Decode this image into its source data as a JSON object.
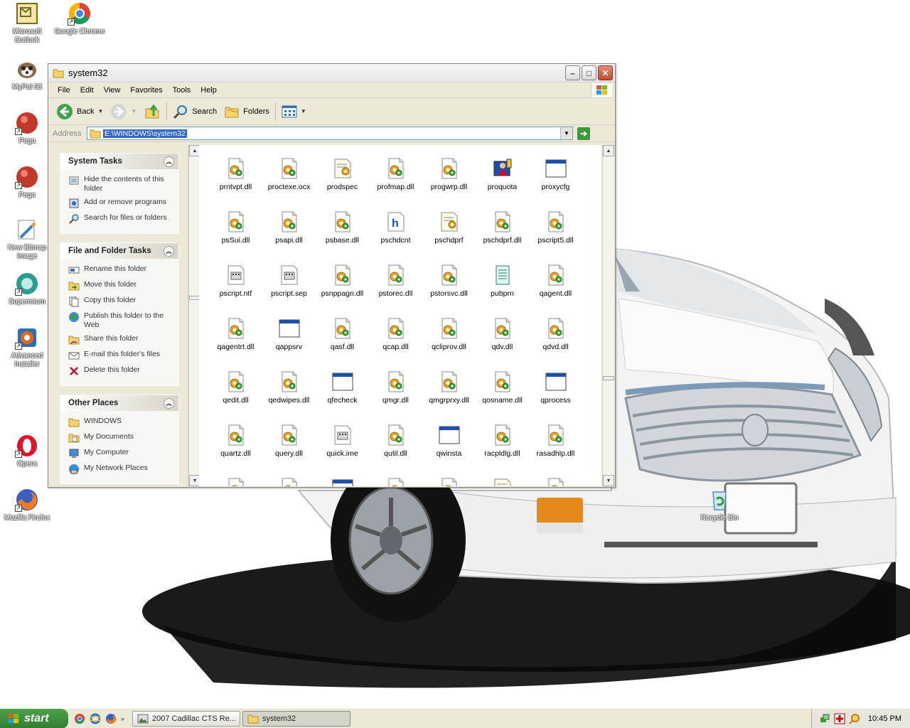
{
  "desktop": {
    "icons": [
      {
        "label": "Microsoft Outlook",
        "icon": "outlook-icon"
      },
      {
        "label": "Google Chrome",
        "icon": "chrome-icon"
      },
      {
        "label": "MyPal 68",
        "icon": "mypal-icon"
      },
      {
        "label": "Pego",
        "icon": "pego-icon"
      },
      {
        "label": "Pego",
        "icon": "pego-icon"
      },
      {
        "label": "New Bitmap Image",
        "icon": "bitmap-icon"
      },
      {
        "label": "Supermium",
        "icon": "supermium-icon"
      },
      {
        "label": "Advanced Installer",
        "icon": "installer-icon"
      },
      {
        "label": "Opera",
        "icon": "opera-icon"
      },
      {
        "label": "Mozilla Firefox",
        "icon": "firefox-icon"
      },
      {
        "label": "Recycle Bin",
        "icon": "recycle-bin-icon"
      }
    ]
  },
  "window": {
    "title": "system32",
    "menu": [
      "File",
      "Edit",
      "View",
      "Favorites",
      "Tools",
      "Help"
    ],
    "toolbar": {
      "back": "Back",
      "search": "Search",
      "folders": "Folders"
    },
    "address": {
      "label": "Address",
      "value": "E:\\WINDOWS\\system32"
    },
    "panels": [
      {
        "title": "System Tasks",
        "tasks": [
          {
            "label": "Hide the contents of this folder",
            "icon": "hide-icon"
          },
          {
            "label": "Add or remove programs",
            "icon": "add-remove-icon"
          },
          {
            "label": "Search for files or folders",
            "icon": "search-icon"
          }
        ]
      },
      {
        "title": "File and Folder Tasks",
        "tasks": [
          {
            "label": "Rename this folder",
            "icon": "rename-icon"
          },
          {
            "label": "Move this folder",
            "icon": "move-icon"
          },
          {
            "label": "Copy this folder",
            "icon": "copy-icon"
          },
          {
            "label": "Publish this folder to the Web",
            "icon": "publish-icon"
          },
          {
            "label": "Share this folder",
            "icon": "share-icon"
          },
          {
            "label": "E-mail this folder's files",
            "icon": "email-icon"
          },
          {
            "label": "Delete this folder",
            "icon": "delete-icon"
          }
        ]
      },
      {
        "title": "Other Places",
        "tasks": [
          {
            "label": "WINDOWS",
            "icon": "folder-icon"
          },
          {
            "label": "My Documents",
            "icon": "documents-icon"
          },
          {
            "label": "My Computer",
            "icon": "computer-icon"
          },
          {
            "label": "My Network Places",
            "icon": "network-icon"
          }
        ]
      }
    ],
    "files": [
      {
        "name": "prntvpt.dll",
        "type": "dll"
      },
      {
        "name": "proctexe.ocx",
        "type": "dll"
      },
      {
        "name": "prodspec",
        "type": "ini"
      },
      {
        "name": "profmap.dll",
        "type": "dll"
      },
      {
        "name": "progwrp.dll",
        "type": "dll"
      },
      {
        "name": "proquota",
        "type": "exe-special"
      },
      {
        "name": "proxycfg",
        "type": "app"
      },
      {
        "name": "psSui.dll",
        "type": "dll"
      },
      {
        "name": "psapi.dll",
        "type": "dll"
      },
      {
        "name": "psbase.dll",
        "type": "dll"
      },
      {
        "name": "pschdcnt",
        "type": "help"
      },
      {
        "name": "pschdprf",
        "type": "ini"
      },
      {
        "name": "pschdprf.dll",
        "type": "dll"
      },
      {
        "name": "pscript5.dll",
        "type": "dll"
      },
      {
        "name": "pscript.ntf",
        "type": "sys"
      },
      {
        "name": "pscript.sep",
        "type": "sys"
      },
      {
        "name": "psnppagn.dll",
        "type": "dll"
      },
      {
        "name": "pstorec.dll",
        "type": "dll"
      },
      {
        "name": "pstorsvc.dll",
        "type": "dll"
      },
      {
        "name": "pubprn",
        "type": "script"
      },
      {
        "name": "qagent.dll",
        "type": "dll"
      },
      {
        "name": "qagentrt.dll",
        "type": "dll"
      },
      {
        "name": "qappsrv",
        "type": "app"
      },
      {
        "name": "qasf.dll",
        "type": "dll"
      },
      {
        "name": "qcap.dll",
        "type": "dll"
      },
      {
        "name": "qcliprov.dll",
        "type": "dll"
      },
      {
        "name": "qdv.dll",
        "type": "dll"
      },
      {
        "name": "qdvd.dll",
        "type": "dll"
      },
      {
        "name": "qedit.dll",
        "type": "dll"
      },
      {
        "name": "qedwipes.dll",
        "type": "dll"
      },
      {
        "name": "qfecheck",
        "type": "app"
      },
      {
        "name": "qmgr.dll",
        "type": "dll"
      },
      {
        "name": "qmgrprxy.dll",
        "type": "dll"
      },
      {
        "name": "qosname.dll",
        "type": "dll"
      },
      {
        "name": "qprocess",
        "type": "app"
      },
      {
        "name": "quartz.dll",
        "type": "dll"
      },
      {
        "name": "query.dll",
        "type": "dll"
      },
      {
        "name": "quick.ime",
        "type": "sys"
      },
      {
        "name": "qutil.dll",
        "type": "dll"
      },
      {
        "name": "qwinsta",
        "type": "app"
      },
      {
        "name": "racpldlg.dll",
        "type": "dll"
      },
      {
        "name": "rasadhlp.dll",
        "type": "dll"
      },
      {
        "name": "",
        "type": "dll"
      },
      {
        "name": "",
        "type": "dll"
      },
      {
        "name": "",
        "type": "app"
      },
      {
        "name": "",
        "type": "dll"
      },
      {
        "name": "",
        "type": "dll"
      },
      {
        "name": "",
        "type": "ini"
      },
      {
        "name": "",
        "type": "dll"
      }
    ]
  },
  "taskbar": {
    "start_label": "start",
    "tasks": [
      {
        "label": "2007 Cadillac CTS Re...",
        "icon": "image-viewer-icon",
        "active": false
      },
      {
        "label": "system32",
        "icon": "folder-icon",
        "active": true
      }
    ],
    "clock": "10:45 PM"
  },
  "colors": {
    "accent": "#316ac5",
    "panel_head": "#d8d4c9",
    "dll_gear": "#e8a21c",
    "dll_green": "#3aa43a"
  }
}
